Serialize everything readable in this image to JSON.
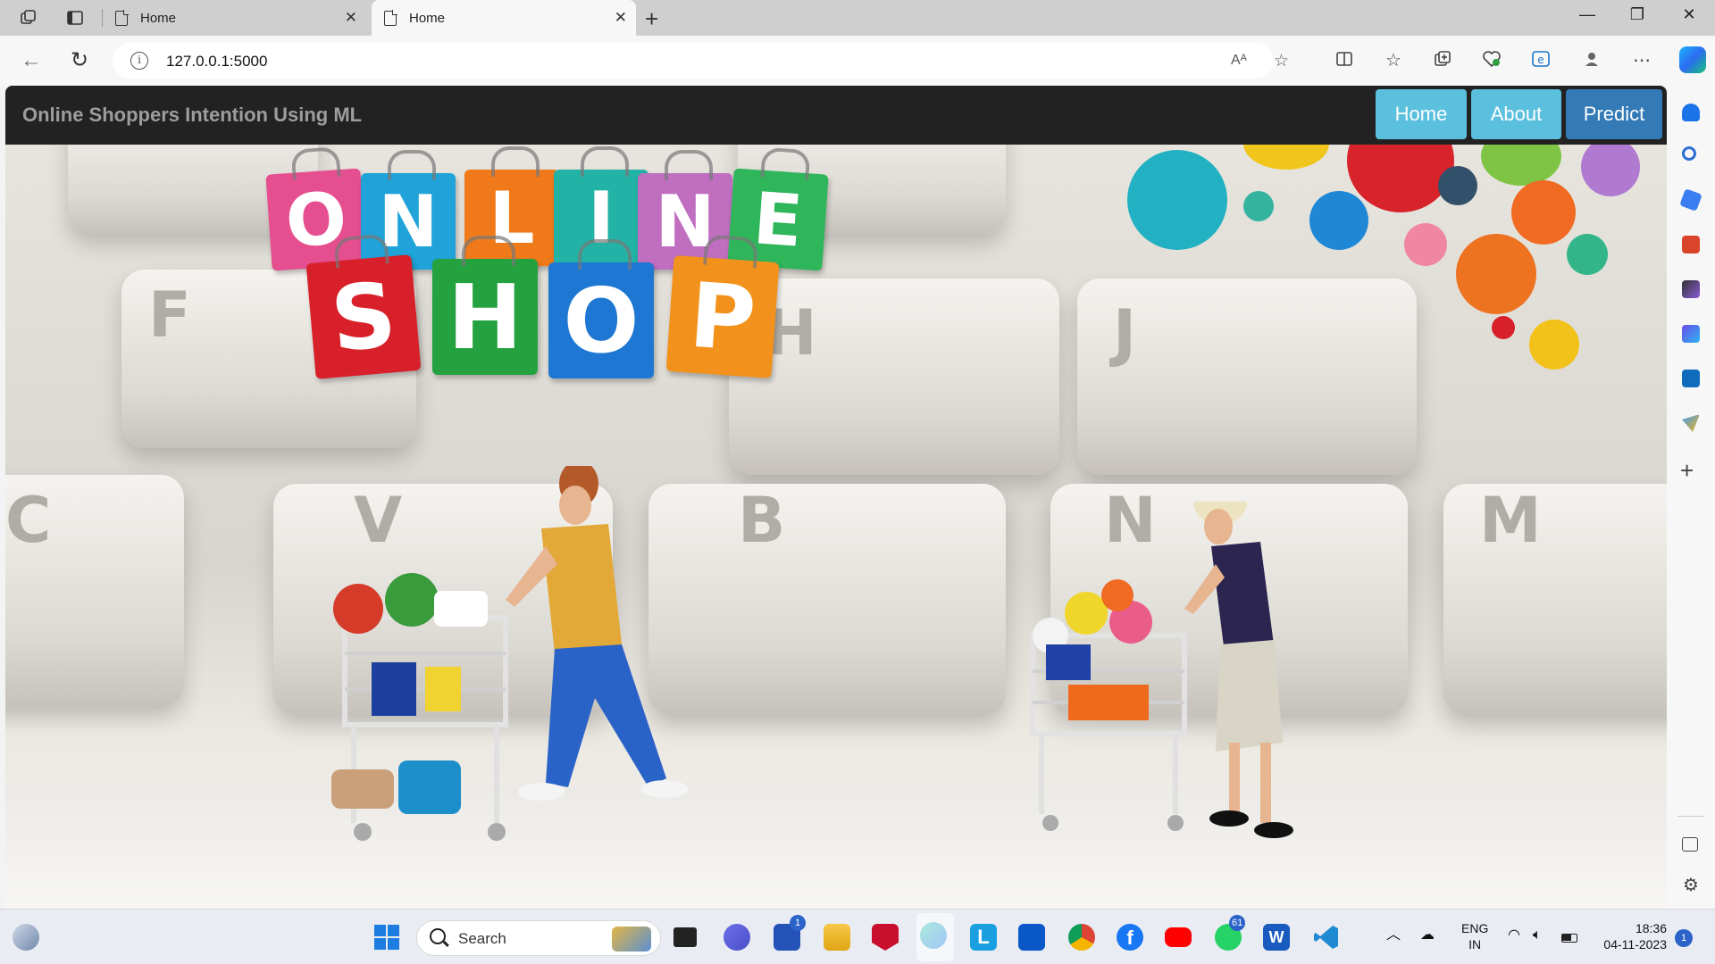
{
  "browser": {
    "tabs": [
      {
        "label": "Home",
        "active": false
      },
      {
        "label": "Home",
        "active": true
      }
    ],
    "url": "127.0.0.1:5000",
    "read_aloud_label": "Aᴬ"
  },
  "page": {
    "brand": "Online Shoppers Intention Using ML",
    "nav": {
      "home": "Home",
      "about": "About",
      "predict": "Predict"
    },
    "hero": {
      "logo_row1": [
        "O",
        "N",
        "L",
        "I",
        "N",
        "E"
      ],
      "logo_row2": [
        "S",
        "H",
        "O",
        "P"
      ],
      "keys": [
        "F",
        "H",
        "J",
        "C",
        "V",
        "B",
        "N",
        "M"
      ]
    }
  },
  "taskbar": {
    "search_placeholder": "Search",
    "store_badge": "1",
    "whatsapp_badge": "61",
    "language": "ENG",
    "region": "IN",
    "time": "18:36",
    "date": "04-11-2023",
    "notification_count": "1"
  },
  "colors": {
    "navbar_bg": "#222222",
    "btn_info": "#5bc0de",
    "btn_primary": "#337ab7",
    "brand_text": "#9d9d9d"
  }
}
